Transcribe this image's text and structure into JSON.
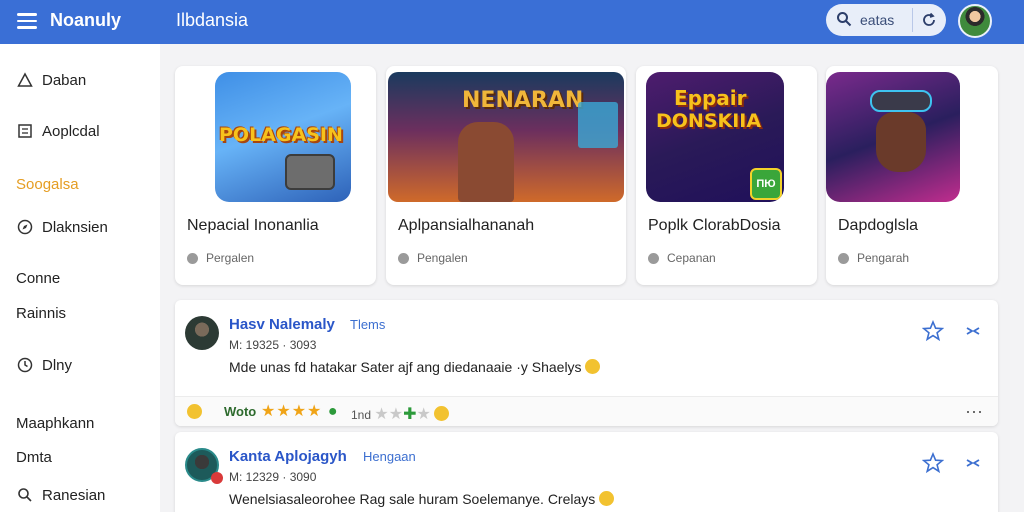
{
  "header": {
    "app_title": "Noanuly",
    "section_title": "Ilbdansia",
    "search_text": "eatas",
    "icons": {
      "menu": "hamburger-menu-icon",
      "search": "search-icon",
      "refresh": "refresh-icon"
    }
  },
  "sidebar": {
    "items": [
      {
        "label": "Daban",
        "icon": "alert-triangle-icon"
      },
      {
        "label": "Aoplcdal",
        "icon": "grid-square-icon"
      },
      {
        "label": "Soogalsa",
        "icon": "",
        "active": true
      },
      {
        "label": "Dlaknsien",
        "icon": "compass-icon"
      },
      {
        "label": "Conne",
        "icon": ""
      },
      {
        "label": "Rainnis",
        "icon": ""
      },
      {
        "label": "Dlny",
        "icon": "clock-icon"
      },
      {
        "label": "Maaphkann",
        "icon": ""
      },
      {
        "label": "Dmta",
        "icon": ""
      },
      {
        "label": "Ranesian",
        "icon": "search-icon"
      }
    ]
  },
  "cards": [
    {
      "title": "Nepacial Inonanlia",
      "subtitle": "Pergalen",
      "logo": "POLAGASIN"
    },
    {
      "title": "Aplpansialhananah",
      "subtitle": "Pengalen",
      "logo": "NENARAN"
    },
    {
      "title": "Poplk ClorabDosia",
      "subtitle": "Cepanan",
      "logo_line1": "Eppair",
      "logo_line2": "DONSKIIA",
      "badge": "ПЮ"
    },
    {
      "title": "Dapdoglsla",
      "subtitle": "Pengarah"
    }
  ],
  "posts": [
    {
      "name": "Hasv Nalemaly",
      "tag": "Tlems",
      "meta": "M: 19325 · 3093",
      "text": "Mde unas fd hatakar Sater ajf ang diedanaaie ·y Shaelys",
      "rating_label": "Woto",
      "rating": 4,
      "rating_count": "1nd",
      "more": "···"
    },
    {
      "name": "Kanta Aplojagyh",
      "tag": "Hengaan",
      "meta": "M: 12329 · 3090",
      "text": "Wenelsiasaleorohee Rag sale huram Soelemanye. Crelays"
    }
  ],
  "colors": {
    "header": "#3a6fd6",
    "accent": "#e59d22",
    "link": "#2a56c8",
    "star": "#f0a417"
  }
}
